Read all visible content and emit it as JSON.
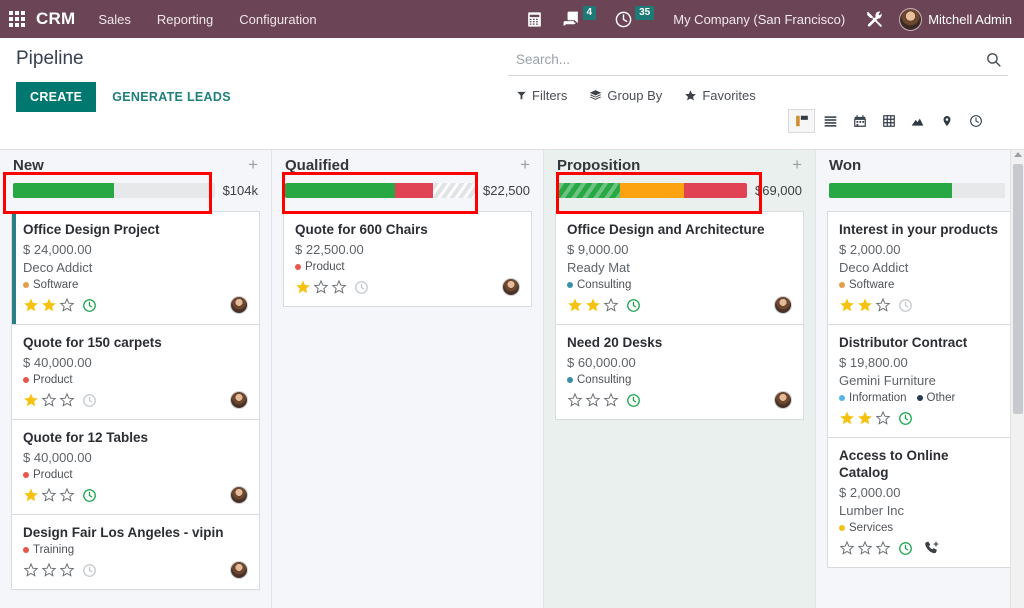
{
  "navbar": {
    "apps_icon": "apps-grid-icon",
    "brand": "CRM",
    "menu": [
      {
        "label": "Sales"
      },
      {
        "label": "Reporting"
      },
      {
        "label": "Configuration"
      }
    ],
    "phone_icon": "phone-icon",
    "messages_icon": "chat-bubble-icon",
    "messages_count": "4",
    "activities_icon": "clock-icon",
    "activities_count": "35",
    "company": "My Company (San Francisco)",
    "debug_icon": "tools-icon",
    "user_name": "Mitchell Admin",
    "user_avatar": "user-avatar"
  },
  "control_panel": {
    "title": "Pipeline",
    "create_label": "CREATE",
    "generate_leads_label": "GENERATE LEADS",
    "search_placeholder": "Search...",
    "search_value": "",
    "search_icon": "search-icon",
    "filters_label": "Filters",
    "group_by_label": "Group By",
    "favorites_label": "Favorites",
    "views": [
      {
        "name": "kanban",
        "icon": "kanban-icon",
        "active": true
      },
      {
        "name": "list",
        "icon": "list-icon",
        "active": false
      },
      {
        "name": "calendar",
        "icon": "calendar-icon",
        "active": false
      },
      {
        "name": "pivot",
        "icon": "pivot-table-icon",
        "active": false
      },
      {
        "name": "graph",
        "icon": "graph-icon",
        "active": false
      },
      {
        "name": "map",
        "icon": "map-pin-icon",
        "active": false
      },
      {
        "name": "activity",
        "icon": "activity-clock-icon",
        "active": false
      }
    ]
  },
  "kanban": {
    "columns": [
      {
        "title": "New",
        "amount": "$104k",
        "add_icon": "plus-icon",
        "highlighted": false,
        "annotated": true,
        "progress": [
          {
            "color": "green",
            "pct": 50
          },
          {
            "color": "grey",
            "pct": 50
          }
        ],
        "cards": [
          {
            "title": "Office Design Project",
            "amount": "$ 24,000.00",
            "partner": "Deco Addict",
            "tags": [
              {
                "label": "Software",
                "color": "#e29e4a"
              }
            ],
            "stars": 2,
            "activity": "green",
            "avatar": true,
            "stripe": true,
            "phone": false
          },
          {
            "title": "Quote for 150 carpets",
            "amount": "$ 40,000.00",
            "partner": "",
            "tags": [
              {
                "label": "Product",
                "color": "#e8554d"
              }
            ],
            "stars": 1,
            "activity": "grey",
            "avatar": true,
            "stripe": false,
            "phone": false
          },
          {
            "title": "Quote for 12 Tables",
            "amount": "$ 40,000.00",
            "partner": "",
            "tags": [
              {
                "label": "Product",
                "color": "#e8554d"
              }
            ],
            "stars": 1,
            "activity": "green",
            "avatar": true,
            "stripe": false,
            "phone": false
          },
          {
            "title": "Design Fair Los Angeles - vipin",
            "amount": "",
            "partner": "",
            "tags": [
              {
                "label": "Training",
                "color": "#e8554d"
              }
            ],
            "stars": 0,
            "activity": "grey",
            "avatar": true,
            "stripe": false,
            "phone": false
          }
        ]
      },
      {
        "title": "Qualified",
        "amount": "$22,500",
        "add_icon": "plus-icon",
        "highlighted": false,
        "annotated": true,
        "progress": [
          {
            "color": "green",
            "pct": 58
          },
          {
            "color": "red",
            "pct": 20
          },
          {
            "color": "stripe-grey",
            "pct": 22
          }
        ],
        "cards": [
          {
            "title": "Quote for 600 Chairs",
            "amount": "$ 22,500.00",
            "partner": "",
            "tags": [
              {
                "label": "Product",
                "color": "#e8554d"
              }
            ],
            "stars": 1,
            "activity": "grey",
            "avatar": true,
            "stripe": false,
            "phone": false
          }
        ]
      },
      {
        "title": "Proposition",
        "amount": "$69,000",
        "add_icon": "plus-icon",
        "highlighted": true,
        "annotated": true,
        "progress": [
          {
            "color": "stripe-green",
            "pct": 33
          },
          {
            "color": "orange",
            "pct": 34
          },
          {
            "color": "red",
            "pct": 33
          }
        ],
        "cards": [
          {
            "title": "Office Design and Architecture",
            "amount": "$ 9,000.00",
            "partner": "Ready Mat",
            "tags": [
              {
                "label": "Consulting",
                "color": "#3a8fa8"
              }
            ],
            "stars": 2,
            "activity": "green",
            "avatar": true,
            "stripe": false,
            "phone": false
          },
          {
            "title": "Need 20 Desks",
            "amount": "$ 60,000.00",
            "partner": "",
            "tags": [
              {
                "label": "Consulting",
                "color": "#3a8fa8"
              }
            ],
            "stars": 0,
            "activity": "green",
            "avatar": true,
            "stripe": false,
            "phone": false
          }
        ]
      },
      {
        "title": "Won",
        "amount": "",
        "add_icon": "",
        "highlighted": false,
        "annotated": false,
        "progress": [
          {
            "color": "green",
            "pct": 70
          },
          {
            "color": "grey",
            "pct": 30
          }
        ],
        "cards": [
          {
            "title": "Interest in your products",
            "amount": "$ 2,000.00",
            "partner": "Deco Addict",
            "tags": [
              {
                "label": "Software",
                "color": "#e29e4a"
              }
            ],
            "stars": 2,
            "activity": "grey",
            "avatar": false,
            "stripe": false,
            "phone": false
          },
          {
            "title": "Distributor Contract",
            "amount": "$ 19,800.00",
            "partner": "Gemini Furniture",
            "tags": [
              {
                "label": "Information",
                "color": "#55b5e8"
              },
              {
                "label": "Other",
                "color": "#2b3a55"
              }
            ],
            "stars": 2,
            "activity": "green",
            "avatar": false,
            "stripe": false,
            "phone": false
          },
          {
            "title": "Access to Online Catalog",
            "amount": "$ 2,000.00",
            "partner": "Lumber Inc",
            "tags": [
              {
                "label": "Services",
                "color": "#f0c419"
              }
            ],
            "stars": 0,
            "activity": "green",
            "avatar": false,
            "stripe": false,
            "phone": true
          }
        ]
      }
    ]
  },
  "colors": {
    "navbar": "#6b4455",
    "primary": "#00786f",
    "annotation": "#ff0000",
    "progress_green": "#28a745",
    "progress_red": "#e04354",
    "progress_orange": "#fca311",
    "star": "#f5c211"
  }
}
